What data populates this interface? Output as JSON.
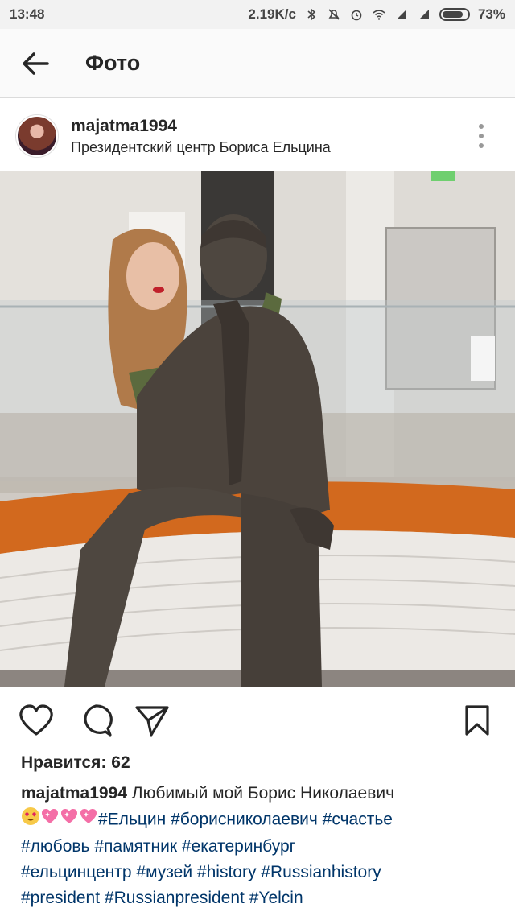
{
  "status_bar": {
    "time": "13:48",
    "speed": "2.19K/c",
    "battery": "73%"
  },
  "app_bar": {
    "title": "Фото",
    "back_icon": "arrow-left-icon"
  },
  "post": {
    "username": "majatma1994",
    "location": "Президентский центр Бориса Ельцина",
    "more_icon": "more-vertical-icon",
    "likes": "Нравится: 62",
    "caption_user": "majatma1994",
    "caption_text": "Любимый мой Борис Николаевич",
    "caption_emojis": [
      "smiling-face-with-heart-eyes",
      "sparkling-heart",
      "sparkling-heart",
      "sparkling-heart"
    ],
    "hashtags": [
      "#Ельцин",
      "#борисниколаевич",
      "#счастье",
      "#любовь",
      "#памятник",
      "#екатеринбург",
      "#ельцинцентр",
      "#музей",
      "#history",
      "#Russianhistory",
      "#president",
      "#Russianpresident",
      "#Yelcin"
    ]
  },
  "actions": {
    "like_icon": "heart-icon",
    "comment_icon": "comment-icon",
    "share_icon": "send-icon",
    "save_icon": "bookmark-icon"
  },
  "colors": {
    "hashtag": "#003569",
    "text": "#262626",
    "divider": "#dbdbdb",
    "bench_orange": "#d2691e"
  }
}
